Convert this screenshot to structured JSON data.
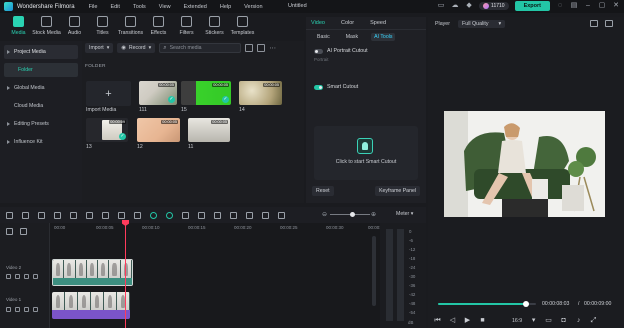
{
  "app": {
    "name": "Wondershare Filmora",
    "document_title": "Untitled",
    "menu": [
      "File",
      "Edit",
      "Tools",
      "View",
      "Extended",
      "Help",
      "Version"
    ],
    "credits": "11710",
    "export_label": "Export"
  },
  "toolbar": {
    "items": [
      {
        "label": "Media",
        "icon": "media-icon",
        "active": true
      },
      {
        "label": "Stock Media",
        "icon": "stock-media-icon",
        "active": false
      },
      {
        "label": "Audio",
        "icon": "music-note-icon",
        "active": false
      },
      {
        "label": "Titles",
        "icon": "text-icon",
        "active": false
      },
      {
        "label": "Transitions",
        "icon": "transitions-icon",
        "active": false
      },
      {
        "label": "Effects",
        "icon": "effects-icon",
        "active": false
      },
      {
        "label": "Filters",
        "icon": "filters-icon",
        "active": false
      },
      {
        "label": "Stickers",
        "icon": "stickers-icon",
        "active": false
      },
      {
        "label": "Templates",
        "icon": "templates-icon",
        "active": false
      }
    ]
  },
  "sidebar": {
    "items": [
      {
        "label": "Project Media"
      },
      {
        "label": "Folder"
      },
      {
        "label": "Global Media"
      },
      {
        "label": "Cloud Media"
      },
      {
        "label": "Editing Presets"
      },
      {
        "label": "Influence Kit"
      }
    ]
  },
  "media": {
    "import_label": "Import",
    "record_label": "Record",
    "search_placeholder": "Search media",
    "folder_label": "FOLDER",
    "import_media_label": "Import Media",
    "thumbnails": [
      {
        "caption": "111",
        "duration": "00:00:05",
        "checked": true
      },
      {
        "caption": "15",
        "duration": "00:00:05",
        "checked": true
      },
      {
        "caption": "14",
        "duration": "00:00:05",
        "checked": false
      },
      {
        "caption": "13",
        "duration": "00:00:09",
        "checked": true
      },
      {
        "caption": "12",
        "duration": "00:00:05",
        "checked": false
      },
      {
        "caption": "11",
        "duration": "00:00:05",
        "checked": false
      }
    ]
  },
  "properties": {
    "tabs": [
      "Video",
      "Color",
      "Speed"
    ],
    "active_tab": "Video",
    "sub_tabs": [
      "Basic",
      "Mask",
      "AI Tools"
    ],
    "active_sub_tab": "AI Tools",
    "ai_portrait_label": "AI Portrait Cutout",
    "ai_portrait_on": false,
    "ai_portrait_hint": "Portrait",
    "smart_cutout_label": "Smart Cutout",
    "smart_cutout_on": true,
    "smart_cutout_cta": "Click to start Smart Cutout",
    "reset_label": "Reset",
    "keyframe_label": "Keyframe Panel"
  },
  "player": {
    "label": "Player",
    "quality": "Full Quality",
    "current_time": "00:00:08:03",
    "total_time": "00:00:09:00",
    "progress": 0.9,
    "ratio": "16:9"
  },
  "timeline": {
    "meter_label": "Meter",
    "ruler_ticks": [
      "00:00",
      "00:00:05",
      "00:00:10",
      "00:00:15",
      "00:00:20",
      "00:00:25",
      "00:00:30",
      "00:00:35"
    ],
    "tracks": [
      {
        "name": "Video 2"
      },
      {
        "name": "Video 1"
      }
    ],
    "db_labels": [
      "0",
      "-6",
      "-12",
      "-18",
      "-24",
      "-30",
      "-36",
      "-42",
      "-48",
      "-54"
    ],
    "db_unit": "dB"
  },
  "colors": {
    "accent": "#23c6a6",
    "playhead": "#ff3b5c",
    "track_video2": "#3d8f80",
    "track_video1": "#7b54c9"
  }
}
